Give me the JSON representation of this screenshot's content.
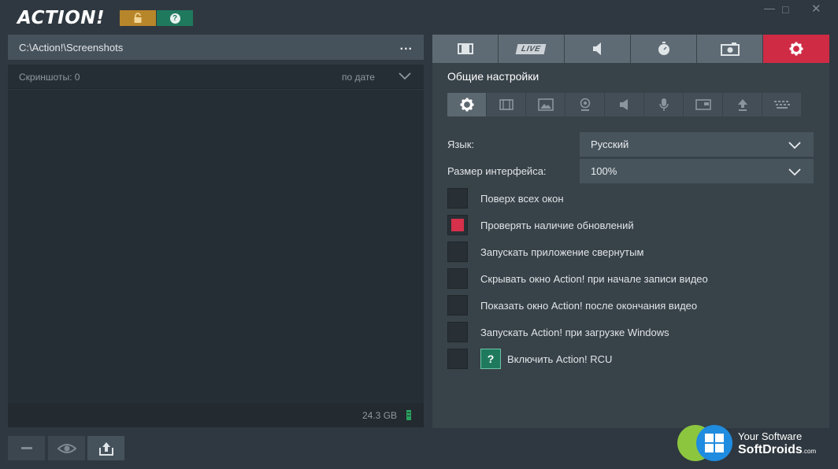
{
  "app": {
    "logo_text": "ACTION!"
  },
  "left_panel": {
    "path": "C:\\Action!\\Screenshots",
    "path_menu": "...",
    "list_count_label": "Скриншоты: 0",
    "sort_label": "по дате",
    "storage_free": "24.3 GB"
  },
  "right_panel": {
    "main_tabs": [
      {
        "icon": "film-icon"
      },
      {
        "label": "LIVE"
      },
      {
        "icon": "speaker-icon"
      },
      {
        "icon": "stopwatch-icon"
      },
      {
        "icon": "camera-icon"
      },
      {
        "icon": "gear-icon",
        "active": true
      }
    ],
    "section_title": "Общие настройки",
    "sub_tabs": [
      "gear-icon",
      "film-icon",
      "image-icon",
      "webcam-icon",
      "speaker-icon",
      "microphone-icon",
      "window-icon",
      "upload-icon",
      "keyboard-icon"
    ],
    "language_label": "Язык:",
    "language_value": "Русский",
    "ui_size_label": "Размер интерфейса:",
    "ui_size_value": "100%",
    "options": [
      {
        "label": "Поверх всех окон",
        "checked": false
      },
      {
        "label": "Проверять наличие обновлений",
        "checked": true
      },
      {
        "label": "Запускать приложение свернутым",
        "checked": false
      },
      {
        "label": "Скрывать окно Action! при начале записи видео",
        "checked": false
      },
      {
        "label": "Показать окно Action! после окончания видео",
        "checked": false
      },
      {
        "label": "Запускать Action! при загрузке Windows",
        "checked": false
      },
      {
        "label": "Включить Action! RCU",
        "checked": false,
        "help": "?"
      }
    ]
  },
  "watermark": {
    "line1": "Your Software",
    "line2": "SoftDroids",
    "suffix": ".com"
  },
  "colors": {
    "accent": "#cf2b45",
    "lock": "#b8862a",
    "help": "#1f7a5d"
  }
}
